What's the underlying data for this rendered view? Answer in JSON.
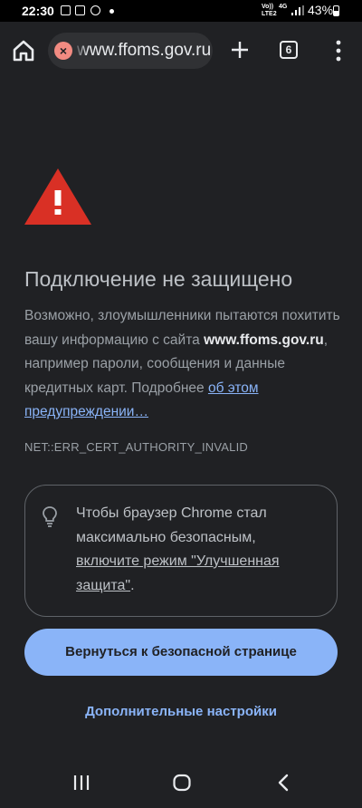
{
  "status_bar": {
    "time": "22:30",
    "network_top": "Vo))",
    "network_bottom": "LTE2",
    "network_type": "4G",
    "battery": "43%"
  },
  "toolbar": {
    "url": "www.ffoms.gov.ru",
    "tab_count": "6"
  },
  "page": {
    "title": "Подключение не защищено",
    "body_part1": "Возможно, злоумышленники пытаются похитить вашу информацию с сайта ",
    "site": "www.ffoms.gov.ru",
    "body_part2": ", например пароли, сообщения и данные кредитных карт. Подробнее ",
    "learn_more_link": "об этом предупреждении…",
    "error_code": "NET::ERR_CERT_AUTHORITY_INVALID",
    "tip_part1": "Чтобы браузер Chrome стал максимально безопасным, ",
    "tip_link": "включите режим \"Улучшенная защита\"",
    "tip_part2": ".",
    "primary_button": "Вернуться к безопасной странице",
    "secondary_link": "Дополнительные настройки"
  },
  "colors": {
    "background": "#202124",
    "accent": "#8ab4f8",
    "warning": "#d93025"
  }
}
